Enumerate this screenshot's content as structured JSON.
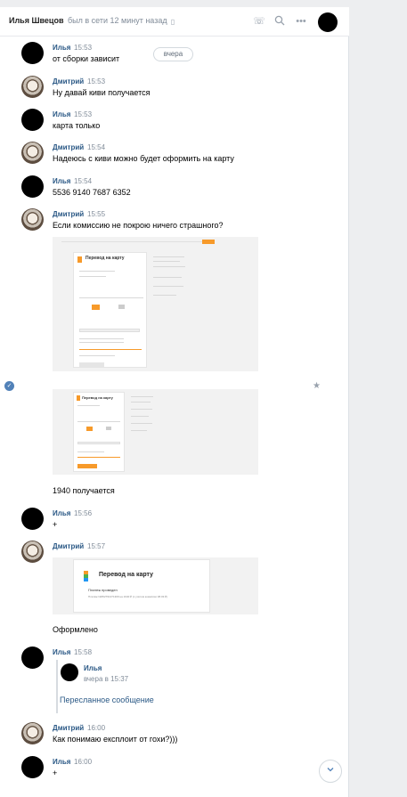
{
  "header": {
    "name": "Илья Швецов",
    "status": "был в сети 12 минут назад",
    "status_icon": "mobile-icon",
    "icons": [
      "phone-icon",
      "search-icon",
      "more-icon"
    ]
  },
  "date_pill": "вчера",
  "messages": [
    {
      "author": "Илья",
      "time": "15:53",
      "text": "от сборки зависит"
    },
    {
      "author": "Дмитрий",
      "time": "15:53",
      "text": "Ну давай киви получается"
    },
    {
      "author": "Илья",
      "time": "15:53",
      "text": "карта только"
    },
    {
      "author": "Дмитрий",
      "time": "15:54",
      "text": "Надеюсь с киви можно будет оформить на карту"
    },
    {
      "author": "Илья",
      "time": "15:54",
      "text": "5536 9140 7687 6352"
    },
    {
      "author": "Дмитрий",
      "time": "15:55",
      "text": "Если комиссию не покрою ничего страшного?"
    },
    {
      "text": "1940 получается"
    },
    {
      "author": "Илья",
      "time": "15:56",
      "text": "+"
    },
    {
      "author": "Дмитрий",
      "time": "15:57"
    },
    {
      "text": "Оформлено"
    },
    {
      "author": "Илья",
      "time": "15:58"
    },
    {
      "author": "Дмитрий",
      "time": "16:00",
      "text": "Как понимаю експлоит от гохи?)))"
    },
    {
      "author": "Илья",
      "time": "16:00",
      "text": "+"
    }
  ],
  "shots": {
    "shot1_title": "Перевод на карту",
    "shot2_title": "Перевод на карту",
    "shot3_title": "Перевод на карту",
    "shot3_sub": "Платеж проведен",
    "shot3_line": "Платёж №652791371309 на 1940 ₽ (с учётом комиссии 38.03 ₽)"
  },
  "forward": {
    "author": "Илья",
    "time": "вчера в 15:37",
    "link": "Пересланное сообщение"
  },
  "icons": {
    "selected": "check-circle-icon",
    "favorite": "star-icon",
    "scroll_down": "chevron-down-icon"
  },
  "colors": {
    "author": "#2a5885",
    "accent": "#5181b8",
    "meta": "#818c99"
  }
}
